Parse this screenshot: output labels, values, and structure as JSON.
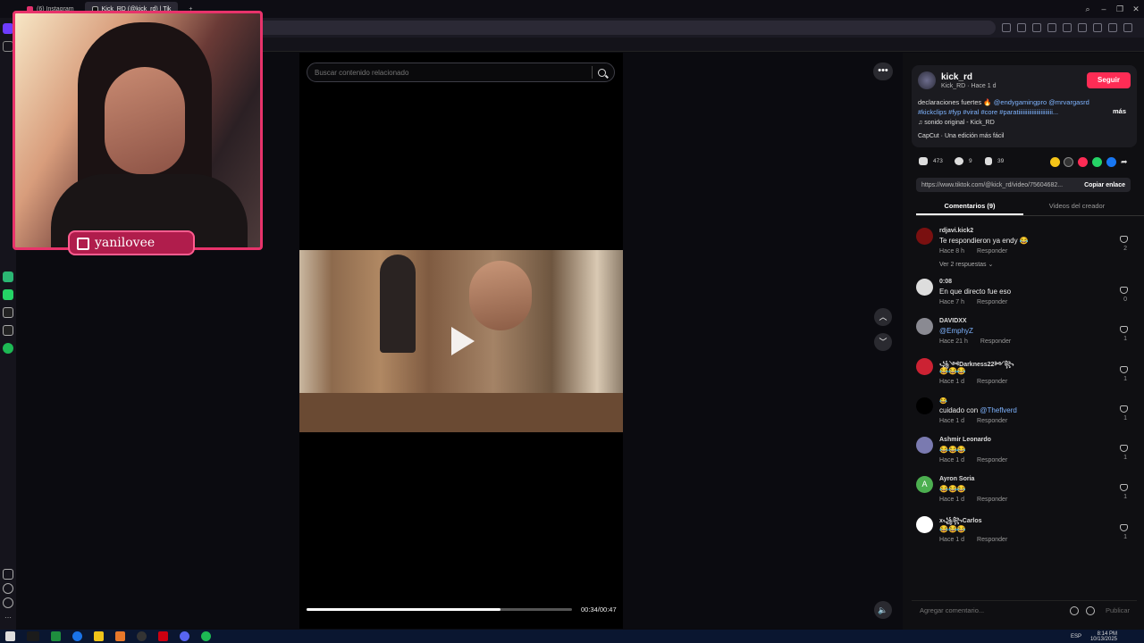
{
  "browser": {
    "tabs": [
      {
        "label": "(6) Instagram",
        "active": false
      },
      {
        "label": "Kick_RD (@kick_rd) | Tik",
        "active": true
      }
    ],
    "new_tab": "+",
    "window_controls": [
      "search",
      "minimize",
      "restore",
      "close"
    ]
  },
  "webcam": {
    "streamer_name": "yanilovee",
    "platform_icon": "twitch-icon"
  },
  "search": {
    "placeholder": "Buscar contenido relacionado"
  },
  "video": {
    "current_time": "00:34",
    "duration": "00:47",
    "time_display": "00:34/00:47",
    "progress": 0.73
  },
  "creator": {
    "username": "kick_rd",
    "subline": "Kick_RD · Hace 1 d",
    "follow_label": "Seguir",
    "description_text": "declaraciones fuertes 🔥 ",
    "description_mentions": "@endygamingpro @mrvargasrd",
    "description_tags": "#kickclips #fyp #viral #core #paratiiiiiiiiiiiiiiiiiiiiiii...",
    "more_label": "más",
    "sound": "♫ sonido original - Kick_RD",
    "capcut": "CapCut · Una edición más fácil"
  },
  "stats": {
    "likes": "473",
    "comments": "9",
    "saves": "39"
  },
  "share": {
    "link": "https://www.tiktok.com/@kick_rd/video/75604682...",
    "copy_label": "Copiar enlace"
  },
  "tabs": {
    "comments": "Comentarios (9)",
    "creator_videos": "Videos del creador"
  },
  "comments": [
    {
      "user": "rdjavi.kick2",
      "text": "Te respondieron ya endy 😂",
      "time": "Hace 8 h",
      "reply": "Responder",
      "likes": "2"
    },
    {
      "user": "0:08",
      "text": "En que directo fue eso",
      "time": "Hace 7 h",
      "reply": "Responder",
      "likes": "0"
    },
    {
      "user": "DAVIDXX",
      "text": "@EmphyZ",
      "time": "Hace 21 h",
      "reply": "Responder",
      "likes": "1"
    },
    {
      "user": "꧁༺Darkness22༻꧂",
      "text": "😂😂😂",
      "time": "Hace 1 d",
      "reply": "Responder",
      "likes": "1"
    },
    {
      "user": "😂",
      "text_plain": "cuidado con ",
      "text": "@Theflverd",
      "time": "Hace 1 d",
      "reply": "Responder",
      "likes": "1"
    },
    {
      "user": "Ashmir Leonardo",
      "text": "😂😂😂",
      "time": "Hace 1 d",
      "reply": "Responder",
      "likes": "1"
    },
    {
      "user": "Ayron Soria",
      "text": "😂😂😂",
      "time": "Hace 1 d",
      "reply": "Responder",
      "likes": "1"
    },
    {
      "user": "x꧁꧂Carlos",
      "text": "😂😂😂",
      "time": "Hace 1 d",
      "reply": "Responder",
      "likes": "1"
    }
  ],
  "replies_label": "Ver 2 respuestas ⌄",
  "comment_input": {
    "placeholder": "Agregar comentario...",
    "publish_label": "Publicar"
  },
  "taskbar": {
    "language": "ESP",
    "time": "8:14 PM",
    "date": "10/13/2025"
  },
  "colors": {
    "accent": "#fe2c55",
    "webcam_border": "#e8336b",
    "mention": "#7fb4ff"
  }
}
